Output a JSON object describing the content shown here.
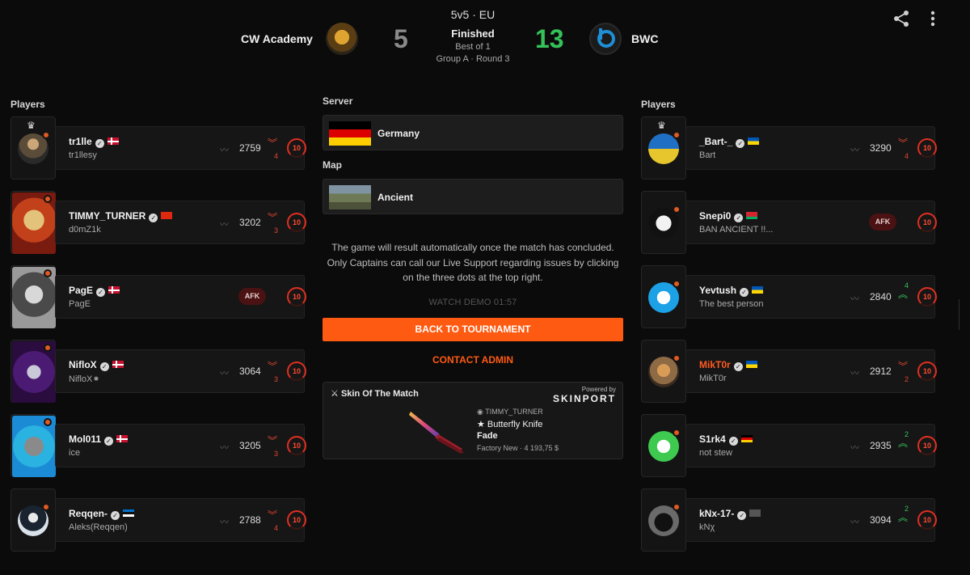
{
  "header": {
    "mode": "5v5 · EU",
    "team_a": {
      "name": "CW Academy",
      "score": "5"
    },
    "team_b": {
      "name": "BWC",
      "score": "13"
    },
    "status": "Finished",
    "format": "Best of 1",
    "stage": "Group A · Round 3",
    "icons": [
      "share-icon",
      "more-vertical-icon"
    ]
  },
  "left": {
    "heading": "Players",
    "players": [
      {
        "name": "tr1lle",
        "sub": "tr1llesy",
        "flag": "dk",
        "elo": "2759",
        "delta": "4",
        "dir": "down",
        "level": "10",
        "captain": true,
        "afk": false
      },
      {
        "name": "TIMMY_TURNER",
        "sub": "d0mZ1k",
        "flag": "cn",
        "elo": "3202",
        "delta": "3",
        "dir": "down",
        "level": "10",
        "afk": false
      },
      {
        "name": "PagE",
        "sub": "PagE",
        "flag": "dk",
        "afk": true,
        "afk_label": "AFK",
        "level": "10"
      },
      {
        "name": "NifloX",
        "sub": "NifloX⁕",
        "flag": "dk",
        "elo": "3064",
        "delta": "3",
        "dir": "down",
        "level": "10",
        "afk": false
      },
      {
        "name": "Mol011",
        "sub": "ice",
        "flag": "dk",
        "elo": "3205",
        "delta": "3",
        "dir": "down",
        "level": "10",
        "afk": false
      },
      {
        "name": "Reqqen-",
        "sub": "Aleks(Reqqen)",
        "flag": "ee",
        "elo": "2788",
        "delta": "4",
        "dir": "down",
        "level": "10",
        "afk": false
      }
    ]
  },
  "right": {
    "heading": "Players",
    "players": [
      {
        "name": "_Bart-_",
        "sub": "Bart",
        "flag": "ua",
        "elo": "3290",
        "delta": "4",
        "dir": "down",
        "level": "10",
        "captain": true,
        "afk": false
      },
      {
        "name": "Snepi0",
        "sub": "BAN ANCIENT !!...",
        "flag": "by",
        "afk": true,
        "afk_label": "AFK",
        "level": "10"
      },
      {
        "name": "Yevtush",
        "sub": "The best person",
        "flag": "ua",
        "elo": "2840",
        "delta": "4",
        "dir": "up",
        "level": "10",
        "afk": false
      },
      {
        "name": "MikT0r",
        "sub": "MikT0r",
        "flag": "ua",
        "elo": "2912",
        "delta": "2",
        "dir": "down",
        "level": "10",
        "afk": false,
        "highlight": true
      },
      {
        "name": "S1rk4",
        "sub": "not stew",
        "flag": "de",
        "elo": "2935",
        "delta": "2",
        "dir": "up",
        "level": "10",
        "afk": false
      },
      {
        "name": "kNx-17-",
        "sub": "kNχ",
        "flag": "xx",
        "elo": "3094",
        "delta": "2",
        "dir": "up",
        "level": "10",
        "afk": false
      }
    ]
  },
  "center": {
    "server_label": "Server",
    "server": "Germany",
    "map_label": "Map",
    "map": "Ancient",
    "info": "The game will result automatically once the match has concluded. Only Captains can call our Live Support regarding issues by clicking on the three dots at the top right.",
    "demo": "WATCH DEMO   01:57",
    "back_button": "BACK TO TOURNAMENT",
    "contact_button": "CONTACT ADMIN",
    "skin": {
      "title": "Skin Of The Match",
      "powered": "Powered by",
      "brand": "SKINPORT",
      "owner": "TIMMY_TURNER",
      "item": "★ Butterfly Knife",
      "finish": "Fade",
      "price": "Factory New · 4 193,75 $"
    }
  },
  "colors": {
    "accent": "#ff5a12",
    "win": "#35c15a",
    "loss": "#e0452e"
  }
}
